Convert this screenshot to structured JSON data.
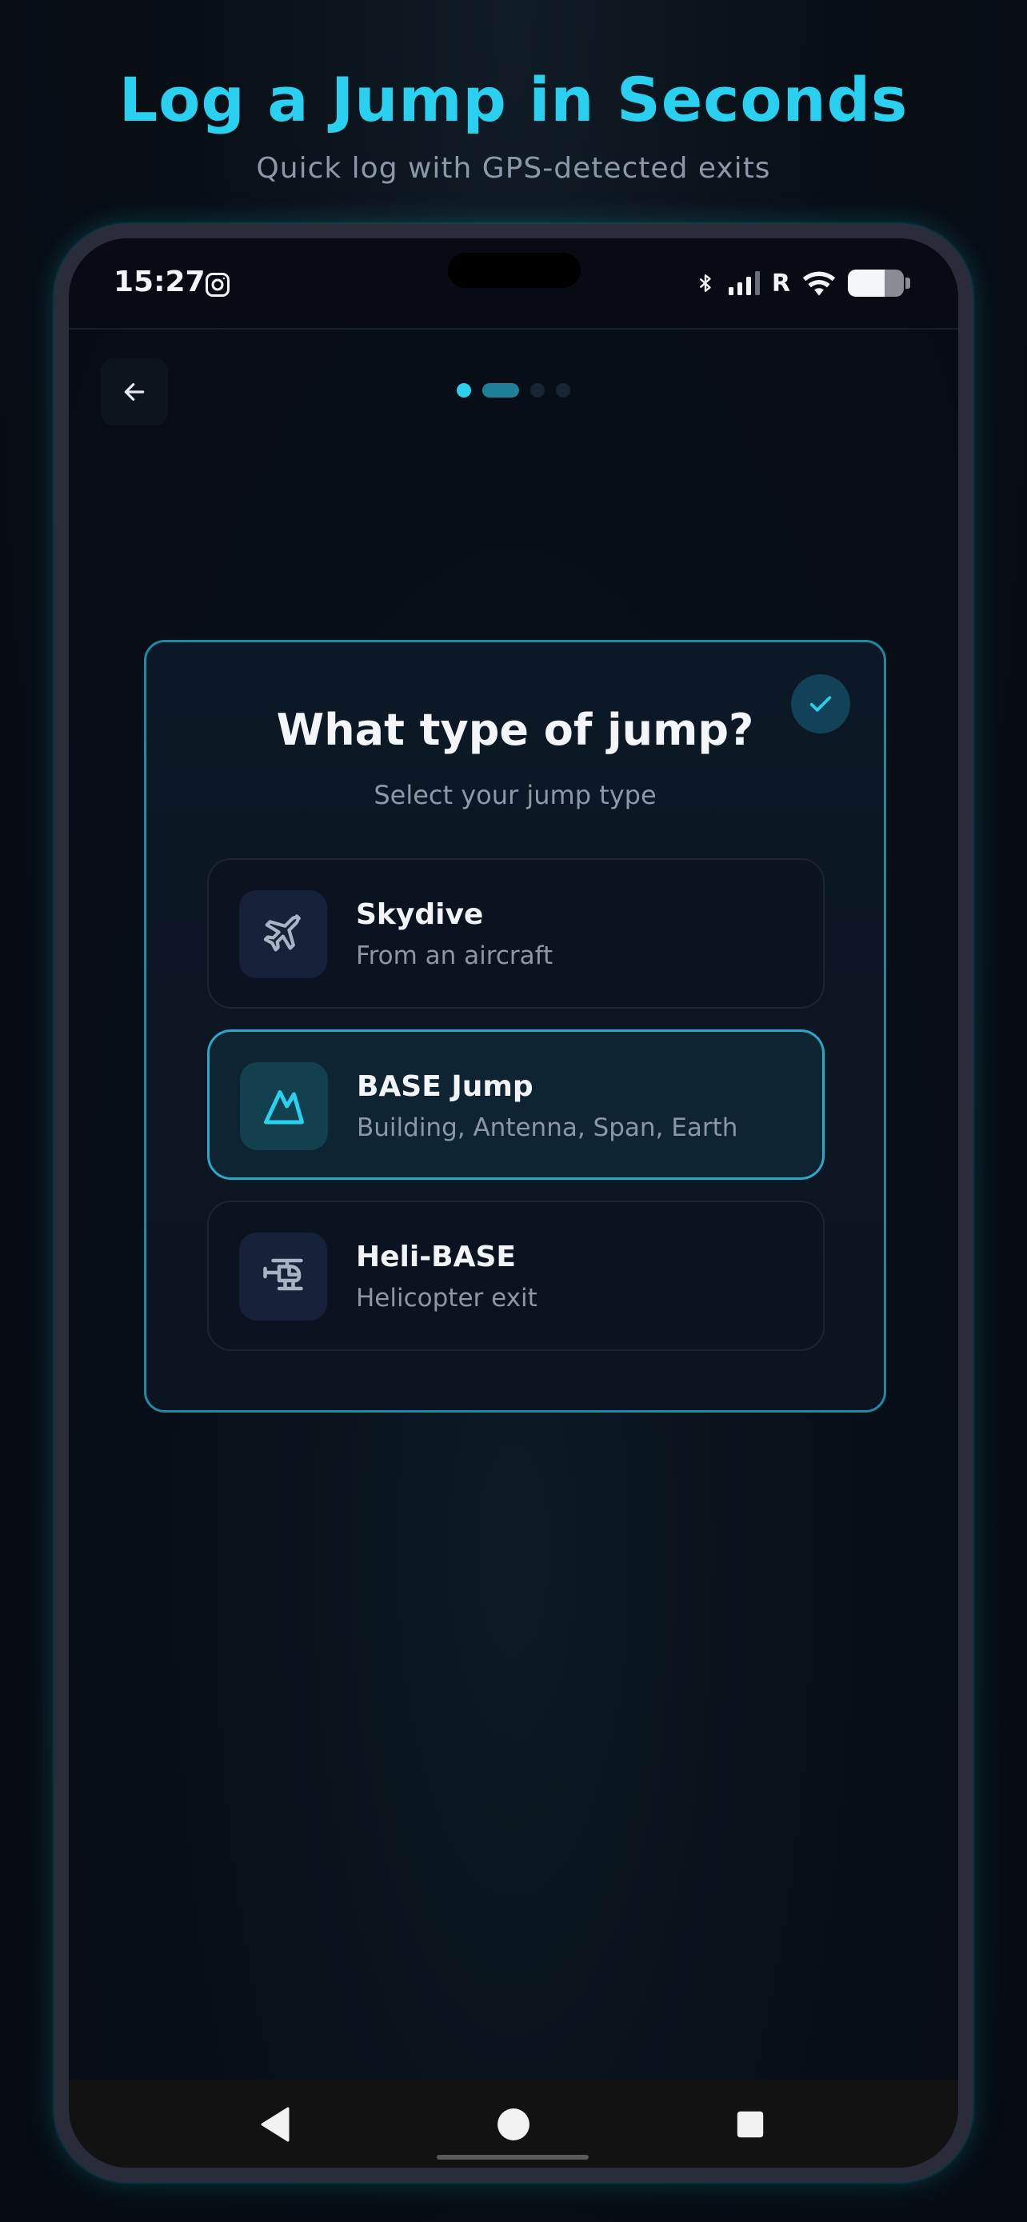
{
  "headline": "Log a Jump in Seconds",
  "subheadline": "Quick log with GPS-detected exits",
  "status_bar": {
    "time": "15:27",
    "network_indicator": "R",
    "icons": [
      "instagram-icon",
      "bluetooth-icon",
      "signal-icon",
      "wifi-icon",
      "battery-icon"
    ]
  },
  "progress": {
    "current_step": 2,
    "total_steps": 4
  },
  "card": {
    "title": "What type of jump?",
    "subtitle": "Select your jump type",
    "selected": "base",
    "options": [
      {
        "id": "skydive",
        "title": "Skydive",
        "description": "From an aircraft",
        "icon": "airplane-icon"
      },
      {
        "id": "base",
        "title": "BASE Jump",
        "description": "Building, Antenna, Span, Earth",
        "icon": "mountain-icon"
      },
      {
        "id": "heli",
        "title": "Heli-BASE",
        "description": "Helicopter exit",
        "icon": "helicopter-icon"
      }
    ]
  },
  "colors": {
    "accent": "#2ad0ef",
    "selected_border": "#2aa8c8",
    "background": "#070d14"
  }
}
